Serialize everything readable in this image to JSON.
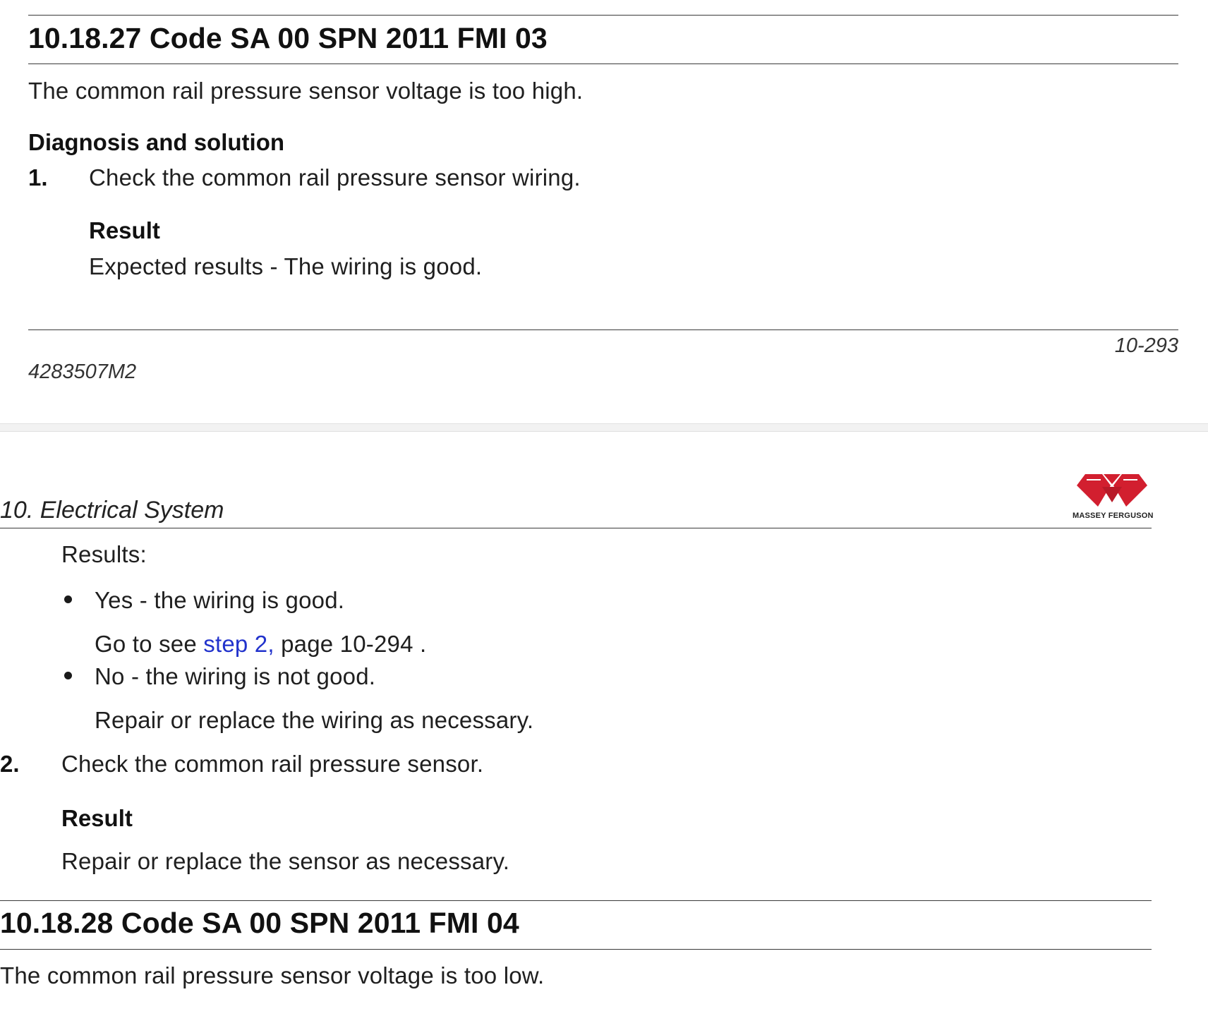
{
  "page1": {
    "section_title": "10.18.27  Code SA 00 SPN 2011 FMI 03",
    "description": "The common rail pressure sensor voltage is too high.",
    "diagnosis_heading": "Diagnosis and solution",
    "step1": {
      "number": "1.",
      "text": "Check the common rail pressure sensor wiring.",
      "result_heading": "Result",
      "expected": "Expected results - The wiring is good."
    },
    "footer": {
      "page_number": "10-293",
      "doc_code": "4283507M2"
    }
  },
  "page2": {
    "chapter_title": "10. Electrical System",
    "logo": {
      "name": "massey-ferguson-logo",
      "text": "MASSEY FERGUSON",
      "color": "#d21f2f"
    },
    "results_label": "Results:",
    "bullets": [
      {
        "text": "Yes - the wiring is good.",
        "action_prefix": "Go to see ",
        "action_link": "step 2,",
        "action_suffix": " page 10-294 ."
      },
      {
        "text": "No - the wiring is not good.",
        "action": "Repair or replace the wiring as necessary."
      }
    ],
    "step2": {
      "number": "2.",
      "text": "Check the common rail pressure sensor.",
      "result_heading": "Result",
      "result_text": "Repair or replace the sensor as necessary."
    },
    "next_section_title": "10.18.28  Code SA 00 SPN 2011 FMI 04",
    "next_description": "The common rail pressure sensor voltage is too low."
  }
}
